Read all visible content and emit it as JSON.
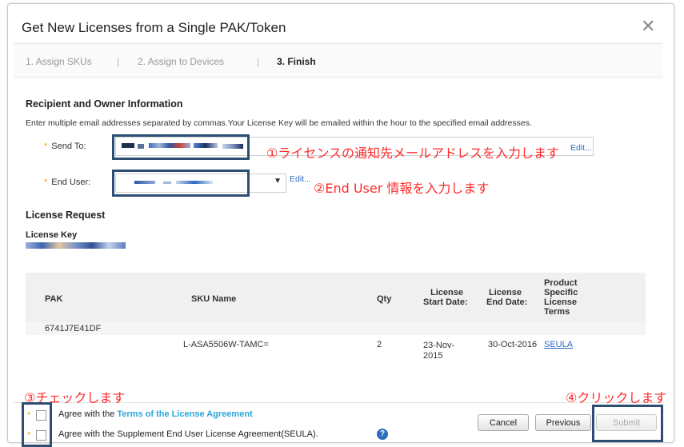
{
  "dialog": {
    "title": "Get New Licenses from a Single PAK/Token"
  },
  "steps": {
    "step1": "1. Assign SKUs",
    "sep": "|",
    "step2": "2. Assign to Devices",
    "step3": "3. Finish"
  },
  "recipient": {
    "heading": "Recipient and Owner Information",
    "helper": "Enter multiple email addresses separated by commas.Your License Key will be emailed within the hour to the specified email addresses.",
    "send_to_label": "Send To:",
    "end_user_label": "End User:",
    "edit_send": "Edit...",
    "edit_end_user": "Edit..."
  },
  "license_request": {
    "heading": "License Request",
    "license_key_label": "License Key"
  },
  "table": {
    "headers": {
      "pak": "PAK",
      "sku": "SKU Name",
      "qty": "Qty",
      "start": [
        "License",
        "Start Date:"
      ],
      "end": [
        "License",
        "End Date:"
      ],
      "terms": [
        "Product",
        "Specific",
        "License",
        "Terms"
      ]
    },
    "pak_value": "6741J7E41DF",
    "row": {
      "sku": "L-ASA5506W-TAMC=",
      "qty": "2",
      "start": [
        "23-Nov-",
        "2015"
      ],
      "end": "30-Oct-2016",
      "terms": "SEULA"
    }
  },
  "agreements": {
    "agree1_prefix": "Agree with the ",
    "agree1_link": "Terms of the License Agreement",
    "agree2": "Agree with the Supplement End User License Agreement(SEULA).",
    "required_star": "*"
  },
  "buttons": {
    "cancel": "Cancel",
    "previous": "Previous",
    "submit": "Submit"
  },
  "annotations": {
    "a1": "①ライセンスの通知先メールアドレスを入力します",
    "a2": "②End User 情報を入力します",
    "a3": "③チェックします",
    "a4": "④クリックします"
  },
  "colors": {
    "annotation": "#ff2b2b",
    "highlight_box": "#2c4e72",
    "link": "#2a6ebb",
    "required": "#f0a000"
  }
}
